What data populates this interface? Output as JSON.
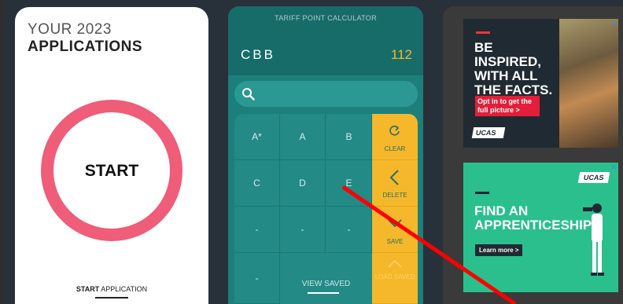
{
  "applications": {
    "year_line": "YOUR 2023",
    "title_line": "APPLICATIONS",
    "start_label": "START",
    "start_app_bold": "START",
    "start_app_rest": " APPLICATION",
    "ring_color": "#ef5d78"
  },
  "calculator": {
    "title": "TARIFF POINT CALCULATOR",
    "grades": "CBB",
    "points": "112",
    "search_icon": "search-icon",
    "grade_keys": [
      "A*",
      "A",
      "B",
      "C",
      "D",
      "E",
      "-",
      "-",
      "-",
      "-"
    ],
    "side_keys": {
      "clear": "CLEAR",
      "delete": "DELETE",
      "save": "SAVE",
      "load_saved": "LOAD SAVED"
    },
    "view_saved": "VIEW SAVED",
    "accent": "#f5b82a",
    "teal": "#1d7f7b"
  },
  "ads": {
    "ad1": {
      "title": "BE INSPIRED, WITH ALL THE FACTS.",
      "cta": "Opt in to get the full picture >",
      "logo": "UCAS",
      "close_icon": "close-icon"
    },
    "ad2": {
      "logo": "UCAS",
      "title": "FIND AN APPRENTICESHIP",
      "cta": "Learn more >",
      "close_icon": "close-icon"
    }
  }
}
